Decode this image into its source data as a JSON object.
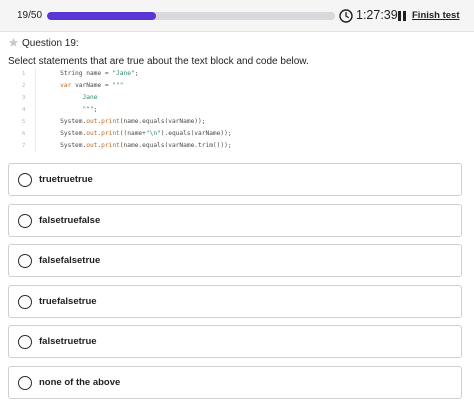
{
  "header": {
    "progress_count": "19/50",
    "progress_fraction": 0.38,
    "timer": "1:27:39",
    "finish_label": "Finish test",
    "accent_color": "#5a36d6"
  },
  "question": {
    "title": "Question 19:",
    "prompt": "Select  statements that are true about the text block and code below."
  },
  "code": {
    "lines": [
      {
        "num": "1",
        "indent": "          ",
        "tokens": [
          {
            "t": "String name = ",
            "c": "plain"
          },
          {
            "t": "\"Jane\"",
            "c": "str"
          },
          {
            "t": ";",
            "c": "plain"
          }
        ]
      },
      {
        "num": "2",
        "indent": "          ",
        "tokens": [
          {
            "t": "var",
            "c": "kw"
          },
          {
            "t": " varName = ",
            "c": "plain"
          },
          {
            "t": "\"\"\"",
            "c": "str"
          }
        ]
      },
      {
        "num": "3",
        "indent": "                ",
        "tokens": [
          {
            "t": "Jane",
            "c": "str"
          }
        ]
      },
      {
        "num": "4",
        "indent": "                ",
        "tokens": [
          {
            "t": "\"\"\"",
            "c": "str"
          },
          {
            "t": ";",
            "c": "plain"
          }
        ]
      },
      {
        "num": "5",
        "indent": "          ",
        "tokens": [
          {
            "t": "System.",
            "c": "plain"
          },
          {
            "t": "out",
            "c": "kw"
          },
          {
            "t": ".",
            "c": "plain"
          },
          {
            "t": "print",
            "c": "fn"
          },
          {
            "t": "(name.equals(varName));",
            "c": "plain"
          }
        ]
      },
      {
        "num": "6",
        "indent": "          ",
        "tokens": [
          {
            "t": "System.",
            "c": "plain"
          },
          {
            "t": "out",
            "c": "kw"
          },
          {
            "t": ".",
            "c": "plain"
          },
          {
            "t": "print",
            "c": "fn"
          },
          {
            "t": "((name+",
            "c": "plain"
          },
          {
            "t": "\"\\n\"",
            "c": "str"
          },
          {
            "t": ").equals(varName));",
            "c": "plain"
          }
        ]
      },
      {
        "num": "7",
        "indent": "          ",
        "tokens": [
          {
            "t": "System.",
            "c": "plain"
          },
          {
            "t": "out",
            "c": "kw"
          },
          {
            "t": ".",
            "c": "plain"
          },
          {
            "t": "print",
            "c": "fn"
          },
          {
            "t": "(name.equals(varName.trim()));",
            "c": "plain"
          }
        ]
      }
    ]
  },
  "options": [
    {
      "label": "truetruetrue"
    },
    {
      "label": "falsetruefalse"
    },
    {
      "label": "falsefalsetrue"
    },
    {
      "label": "truefalsetrue"
    },
    {
      "label": "falsetruetrue"
    },
    {
      "label": "none of the above"
    }
  ]
}
